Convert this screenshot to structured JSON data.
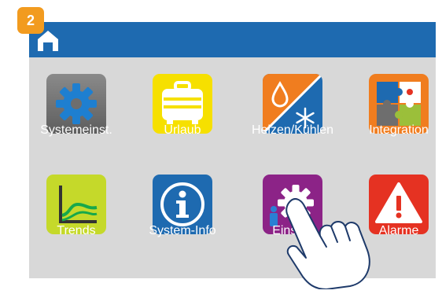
{
  "step_number": "2",
  "header": {
    "home_icon": "home-icon"
  },
  "tiles": [
    {
      "label": "Systemeinst.",
      "icon": "gear-icon",
      "color": "#6e6e6e"
    },
    {
      "label": "Urlaub",
      "icon": "suitcase-icon",
      "color": "#f6e000"
    },
    {
      "label": "Heizen/Kühlen",
      "icon": "heat-cool-icon",
      "color": "#1e6ab0"
    },
    {
      "label": "Integration",
      "icon": "puzzle-icon",
      "color": "#f07d1f"
    },
    {
      "label": "Trends",
      "icon": "trend-chart-icon",
      "color": "#c5d92a"
    },
    {
      "label": "System-Info",
      "icon": "info-icon",
      "color": "#1e6ab0"
    },
    {
      "label": "Einstell",
      "icon": "person-gear-icon",
      "color": "#8c2387"
    },
    {
      "label": "Alarme",
      "icon": "warning-icon",
      "color": "#e53222"
    }
  ],
  "colors": {
    "header": "#1e6ab0",
    "background": "#d8d8d8",
    "badge": "#f29b1f"
  }
}
